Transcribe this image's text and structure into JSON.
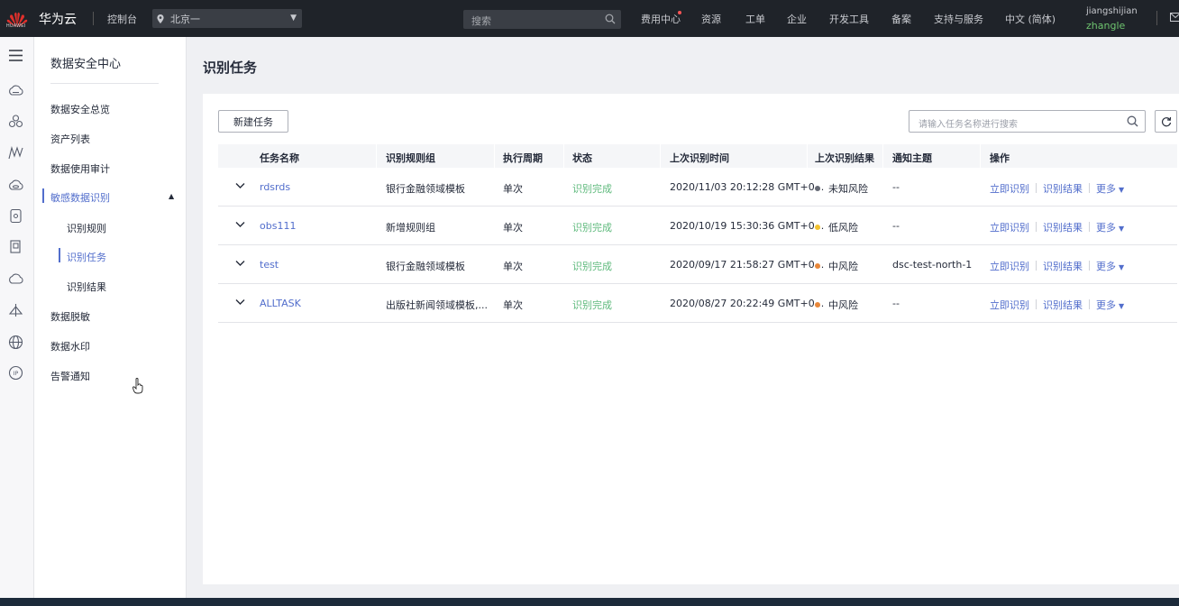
{
  "topbar": {
    "logo_text": "HUAWEI",
    "brand": "华为云",
    "console": "控制台",
    "region": "北京一",
    "search_placeholder": "搜索",
    "nav": [
      "费用中心",
      "资源",
      "工单",
      "企业",
      "开发工具",
      "备案",
      "支持与服务",
      "中文 (简体)"
    ],
    "user_account": "jiangshijian",
    "user_name": "zhangle"
  },
  "sidebar": {
    "title": "数据安全中心",
    "items": [
      "数据安全总览",
      "资产列表",
      "数据使用审计",
      "敏感数据识别",
      "识别规则",
      "识别任务",
      "识别结果",
      "数据脱敏",
      "数据水印",
      "告警通知"
    ]
  },
  "rail_icons": [
    "menu-icon",
    "cloud-server-icon",
    "cluster-icon",
    "network-icon",
    "cloud-storage-icon",
    "database-icon",
    "document-icon",
    "cloud-icon",
    "security-icon",
    "globe-icon",
    "ip-icon"
  ],
  "main": {
    "title": "识别任务",
    "new_button": "新建任务",
    "search_placeholder": "请输入任务名称进行搜索"
  },
  "table": {
    "columns": [
      "任务名称",
      "识别规则组",
      "执行周期",
      "状态",
      "上次识别时间",
      "上次识别结果",
      "通知主题",
      "操作"
    ],
    "rows": [
      {
        "name": "rdsrds",
        "rule_group": "银行金融领域模板",
        "cycle": "单次",
        "status": "识别完成",
        "last_time": "2020/11/03 20:12:28 GMT+0...",
        "result": "未知风险",
        "topic": "--"
      },
      {
        "name": "obs111",
        "rule_group": "新增规则组",
        "cycle": "单次",
        "status": "识别完成",
        "last_time": "2020/10/19 15:30:36 GMT+0...",
        "result": "低风险",
        "topic": "--"
      },
      {
        "name": "test",
        "rule_group": "银行金融领域模板",
        "cycle": "单次",
        "status": "识别完成",
        "last_time": "2020/09/17 21:58:27 GMT+0...",
        "result": "中风险",
        "topic": "dsc-test-north-1"
      },
      {
        "name": "ALLTASK",
        "rule_group": "出版社新闻领域模板,...",
        "cycle": "单次",
        "status": "识别完成",
        "last_time": "2020/08/27 20:22:49 GMT+0...",
        "result": "中风险",
        "topic": "--"
      }
    ],
    "actions": {
      "identify": "立即识别",
      "results": "识别结果",
      "more": "更多"
    }
  },
  "colors": {
    "link": "#526ecc",
    "done": "#5fba7d",
    "unknown": "#666a75",
    "low": "#f2c230",
    "medium": "#e8873a",
    "topbar": "#1f2329"
  }
}
